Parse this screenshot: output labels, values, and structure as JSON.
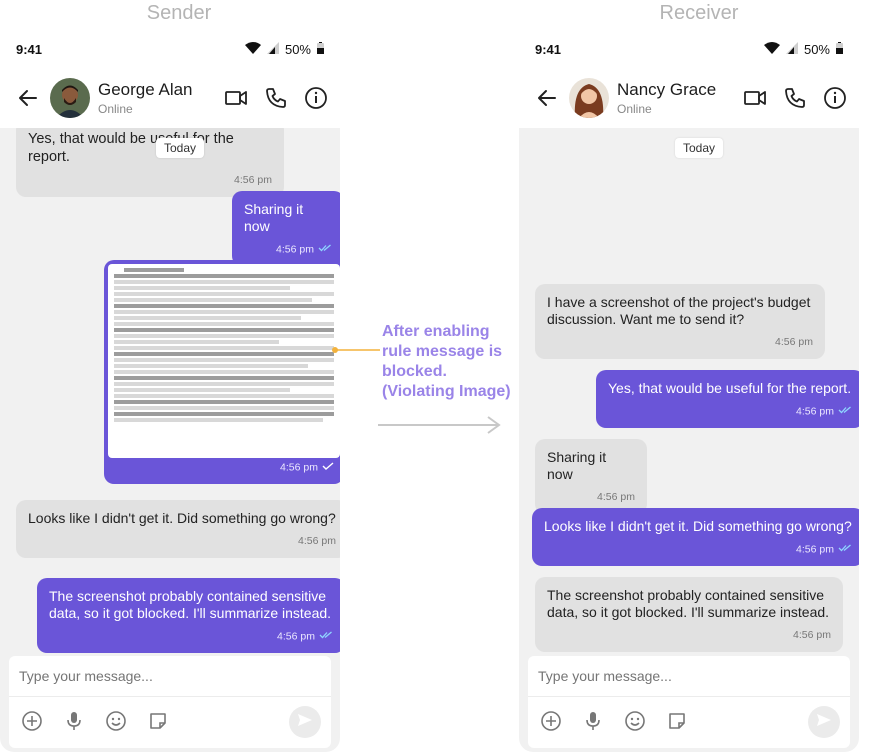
{
  "captions": {
    "sender": "Sender",
    "receiver": "Receiver"
  },
  "annotation": {
    "text": "After enabling rule message is blocked. (Violating Image)"
  },
  "sender": {
    "status": {
      "time": "9:41",
      "battery": "50%"
    },
    "contact": {
      "name": "George Alan",
      "presence": "Online"
    },
    "today_label": "Today",
    "messages": [
      {
        "text": "Yes, that would be useful for the report.",
        "time": "4:56 pm"
      },
      {
        "text": "Sharing it now",
        "time": "4:56 pm"
      },
      {
        "text": "",
        "time": "4:56 pm"
      },
      {
        "text": "Looks like I didn't get it. Did something go wrong?",
        "time": "4:56 pm"
      },
      {
        "text": "The screenshot probably contained sensitive data, so it got blocked. I'll summarize instead.",
        "time": "4:56 pm"
      }
    ],
    "composer": {
      "placeholder": "Type your message..."
    }
  },
  "receiver": {
    "status": {
      "time": "9:41",
      "battery": "50%"
    },
    "contact": {
      "name": "Nancy Grace",
      "presence": "Online"
    },
    "today_label": "Today",
    "messages": [
      {
        "text": "I have a screenshot of the project's budget discussion. Want me to send it?",
        "time": "4:56 pm"
      },
      {
        "text": "Yes, that would be useful for the report.",
        "time": "4:56 pm"
      },
      {
        "text": "Sharing it now",
        "time": "4:56 pm"
      },
      {
        "text": "Looks like I didn't get it. Did something go wrong?",
        "time": "4:56 pm"
      },
      {
        "text": "The screenshot probably contained sensitive data, so it got blocked. I'll summarize instead.",
        "time": "4:56 pm"
      }
    ],
    "composer": {
      "placeholder": "Type your message..."
    }
  },
  "colors": {
    "accent": "#6a55d8",
    "incoming": "#e1e1e1",
    "annotation": "#9a84e8"
  },
  "icons": [
    "back-arrow-icon",
    "video-call-icon",
    "phone-icon",
    "info-icon",
    "add-icon",
    "mic-icon",
    "emoji-icon",
    "sticker-icon",
    "send-icon",
    "read-check-icon",
    "wifi-icon",
    "signal-icon",
    "battery-icon"
  ]
}
